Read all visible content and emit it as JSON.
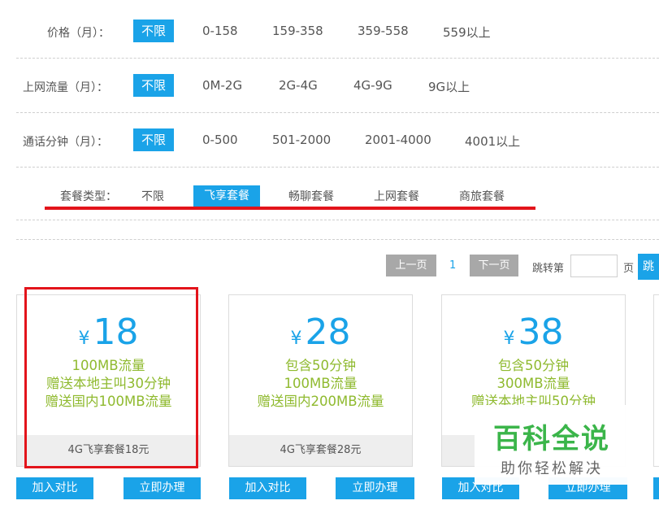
{
  "filters": {
    "price": {
      "label": "价格（月）：",
      "options": [
        "不限",
        "0-158",
        "159-358",
        "359-558",
        "559以上"
      ]
    },
    "data": {
      "label": "上网流量（月）：",
      "options": [
        "不限",
        "0M-2G",
        "2G-4G",
        "4G-9G",
        "9G以上"
      ]
    },
    "calls": {
      "label": "通话分钟（月）：",
      "options": [
        "不限",
        "0-500",
        "501-2000",
        "2001-4000",
        "4001以上"
      ]
    }
  },
  "plan_type": {
    "label": "套餐类型：",
    "tabs": [
      "不限",
      "飞享套餐",
      "畅聊套餐",
      "上网套餐",
      "商旅套餐"
    ],
    "selected": "飞享套餐"
  },
  "pagination": {
    "prev": "上一页",
    "current": "1",
    "next": "下一页",
    "jump_label": "跳转第",
    "page_suffix": "页",
    "go": "跳"
  },
  "cards": [
    {
      "currency": "¥",
      "price": "18",
      "features": [
        "100MB流量",
        "赠送本地主叫30分钟",
        "赠送国内100MB流量"
      ],
      "name": "4G飞享套餐18元"
    },
    {
      "currency": "¥",
      "price": "28",
      "features": [
        "包含50分钟",
        "100MB流量",
        "赠送国内200MB流量"
      ],
      "name": "4G飞享套餐28元"
    },
    {
      "currency": "¥",
      "price": "38",
      "features": [
        "包含50分钟",
        "300MB流量",
        "赠送本地主叫50分钟"
      ],
      "name": ""
    }
  ],
  "actions": {
    "compare": "加入对比",
    "apply": "立即办理"
  },
  "watermark": {
    "title": "百科全说",
    "subtitle": "助你轻松解决"
  },
  "colors": {
    "accent": "#1aa3e8",
    "feature_green": "#8fba2f",
    "annotation_red": "#e3141b",
    "gray_button": "#a8a8a8"
  }
}
